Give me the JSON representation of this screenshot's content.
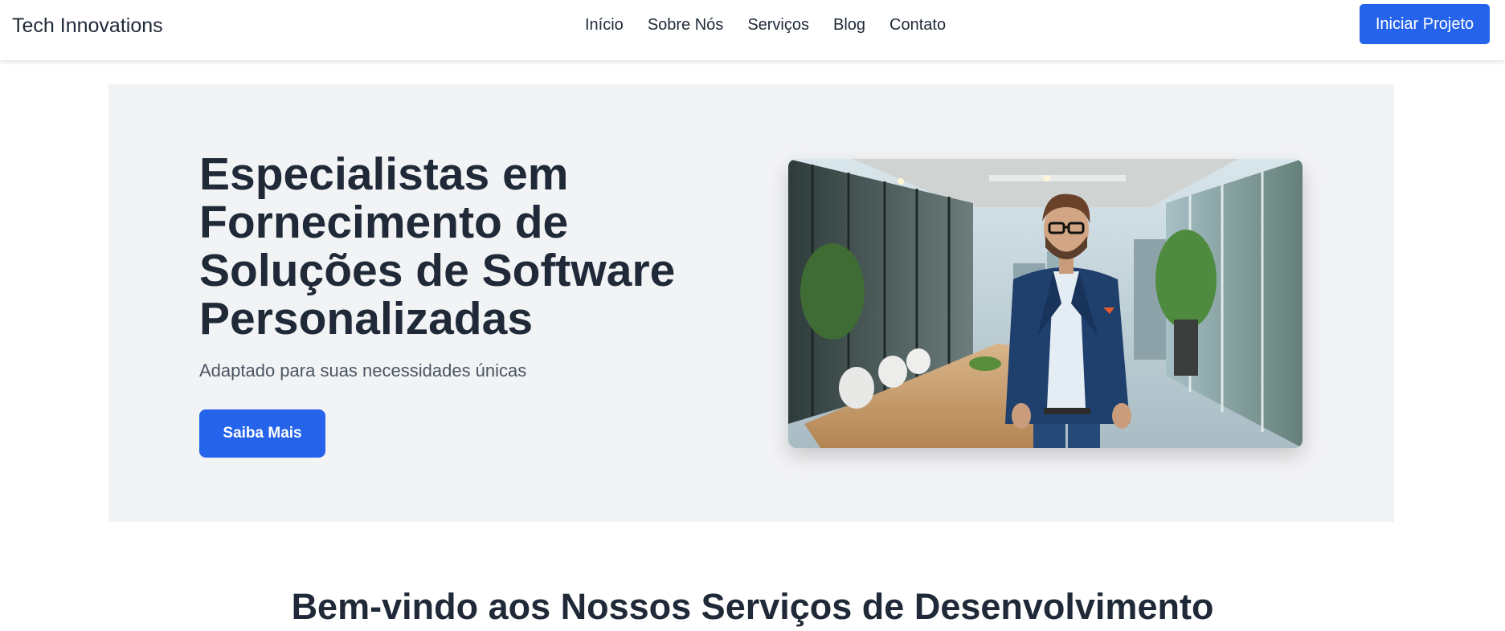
{
  "nav": {
    "brand": "Tech Innovations",
    "links": [
      "Início",
      "Sobre Nós",
      "Serviços",
      "Blog",
      "Contato"
    ],
    "cta_label": "Iniciar Projeto"
  },
  "hero": {
    "title": "Especialistas em Fornecimento de Soluções de Software Personalizadas",
    "subtitle": "Adaptado para suas necessidades únicas",
    "button_label": "Saiba Mais",
    "image_subject": "businessman-in-office-photo"
  },
  "section": {
    "title": "Bem-vindo aos Nossos Serviços de Desenvolvimento"
  },
  "colors": {
    "accent": "#2563eb",
    "hero_background": "#f2f3f5",
    "text_dark": "#1f2937"
  }
}
